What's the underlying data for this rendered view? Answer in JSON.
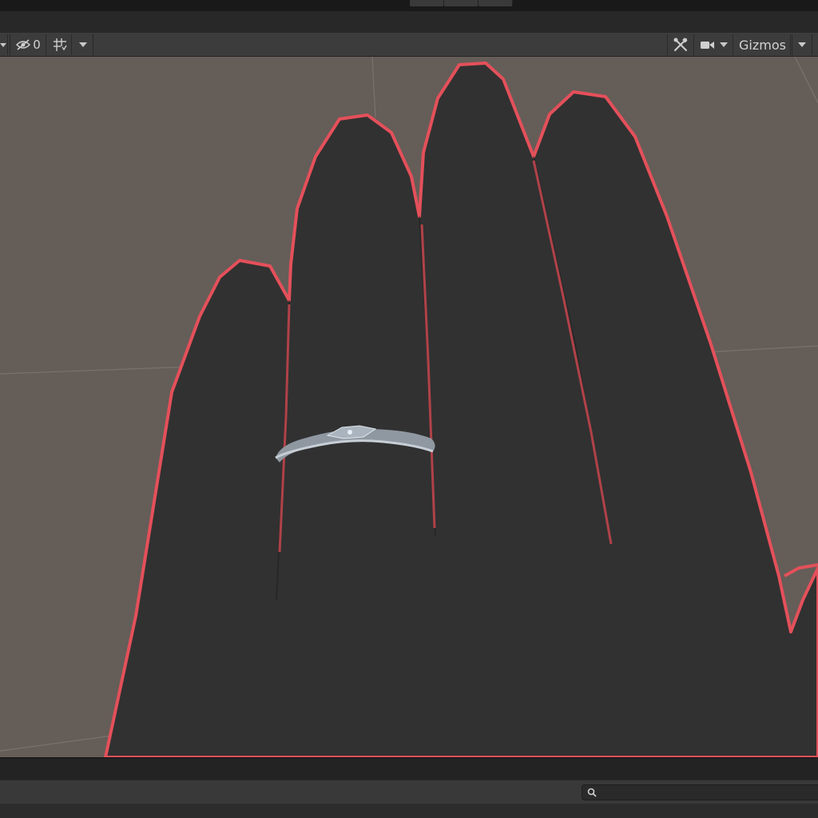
{
  "scene_toolbar": {
    "hidden_count": "0",
    "gizmos_label": "Gizmos",
    "icons": {
      "visibility": "eye-slash-icon",
      "grid": "grid-snap-icon",
      "tools": "tools-icon",
      "camera": "camera-icon"
    }
  },
  "viewport": {
    "background_color": "#655d58",
    "hand_color": "#313131",
    "outline_color": "#e4505a",
    "ring_color": "#9aa3ad"
  },
  "search": {
    "placeholder": "",
    "icon": "search-icon"
  }
}
